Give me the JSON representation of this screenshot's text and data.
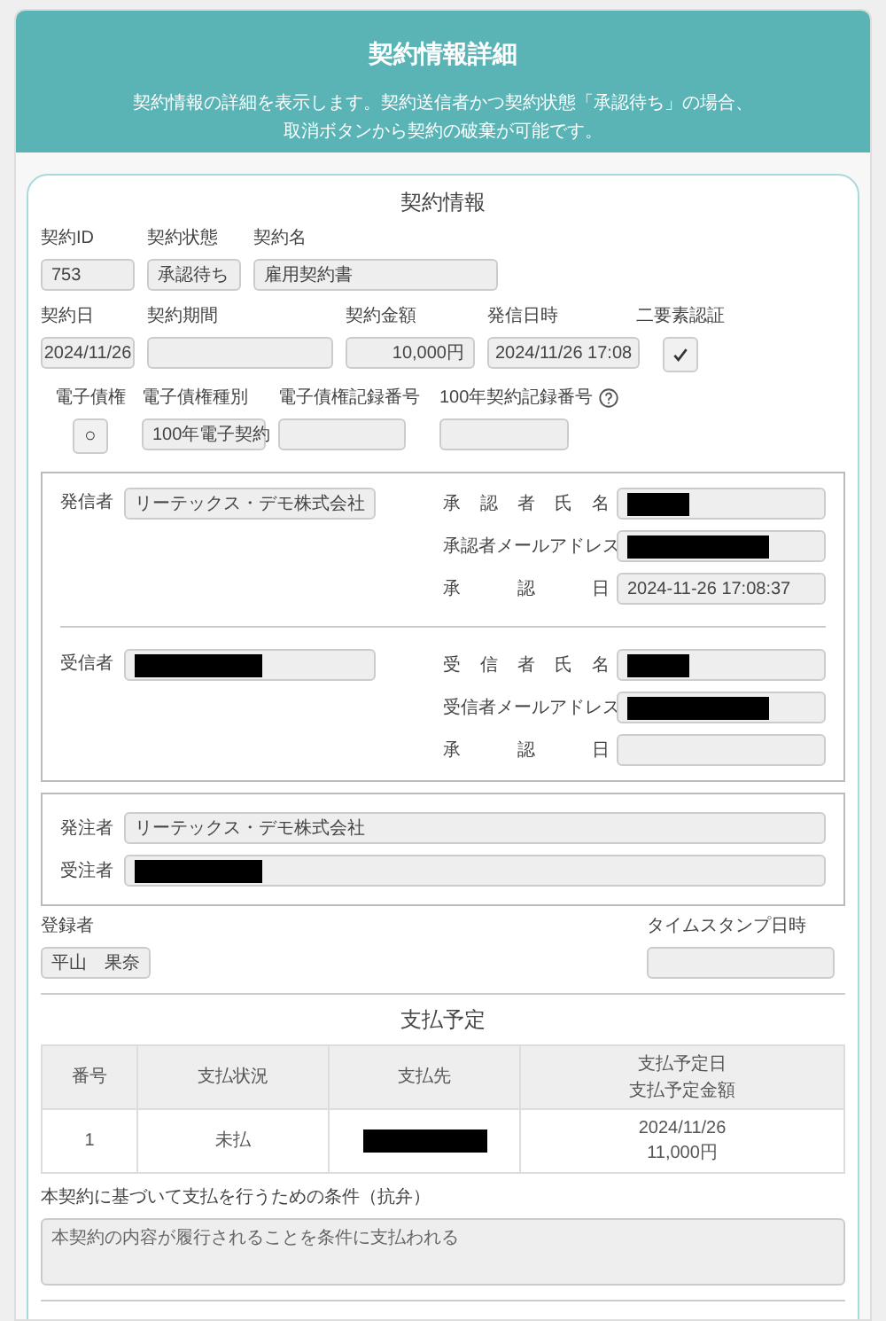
{
  "header": {
    "title": "契約情報詳細",
    "description": [
      "契約情報の詳細を表示します。契約送信者かつ契約状態「承認待ち」の場合、",
      "取消ボタンから契約の破棄が可能です。"
    ]
  },
  "contract_info": {
    "title": "契約情報",
    "rows": [
      [
        {
          "label": "契約ID",
          "kind": "text",
          "value": "753"
        },
        {
          "label": "契約状態",
          "kind": "text",
          "value": "承認待ち"
        },
        {
          "label": "契約名",
          "kind": "text",
          "value": "雇用契約書"
        }
      ],
      [
        {
          "label": "契約日",
          "kind": "date",
          "value": "2024/11/26"
        },
        {
          "label": "契約期間",
          "kind": "text"
        },
        {
          "label": "契約金額",
          "kind": "number",
          "value": "10,000円"
        },
        {
          "label": "発信日時",
          "kind": "date",
          "value": "2024/11/26 17:08"
        },
        {
          "label": "二要素認証",
          "kind": "check",
          "checked": true
        }
      ],
      [
        {
          "label": "電子債権",
          "kind": "mark",
          "value": "○"
        },
        {
          "label": "電子債権種別",
          "kind": "text",
          "value": "100年電子契約"
        },
        {
          "label": "電子債権記録番号",
          "kind": "text"
        },
        {
          "label": "100年契約記録番号",
          "kind": "text",
          "help": true
        }
      ]
    ]
  },
  "parties": [
    {
      "label": "発信者",
      "value": "リーテックス・デモ株式会社",
      "fields": [
        {
          "label": "承認者氏名",
          "redacted": true
        },
        {
          "label": "承認者メールアドレス",
          "redacted": true
        },
        {
          "label": "承認日",
          "value": "2024-11-26 17:08:37"
        }
      ]
    },
    {
      "label": "受信者",
      "redacted": true,
      "fields": [
        {
          "label": "受信者氏名",
          "redacted": true
        },
        {
          "label": "受信者メールアドレス",
          "redacted": true
        },
        {
          "label": "承認日"
        }
      ]
    }
  ],
  "orders": [
    {
      "label": "発注者",
      "value": "リーテックス・デモ株式会社"
    },
    {
      "label": "受注者",
      "redacted": true
    }
  ],
  "registrant": {
    "label": "登録者",
    "value": "平山　果奈"
  },
  "timestamp": {
    "label": "タイムスタンプ日時"
  },
  "payment": {
    "title": "支払予定",
    "columns": [
      [
        "番号"
      ],
      [
        "支払状況"
      ],
      [
        "支払先"
      ],
      [
        "支払予定日",
        "支払予定金額"
      ]
    ],
    "rows": [
      {
        "number": "1",
        "status": "未払",
        "payee_redacted": true,
        "date": "2024/11/26",
        "amount": "11,000円"
      }
    ]
  },
  "condition": {
    "label": "本契約に基づいて支払を行うための条件（抗弁）",
    "value": "本契約の内容が履行されることを条件に支払われる"
  }
}
